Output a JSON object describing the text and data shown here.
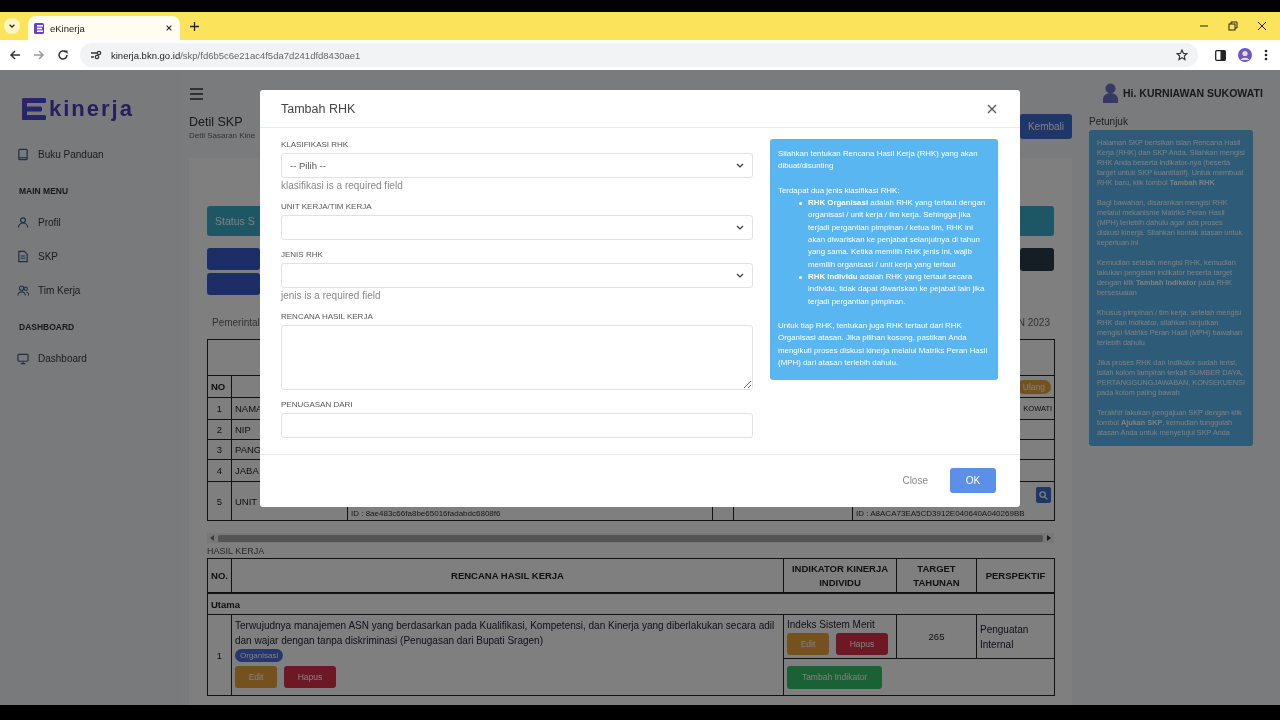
{
  "browser": {
    "tab_title": "eKinerja",
    "url": {
      "domain": "kinerja.bkn.go.id",
      "path": "/skp/fd6b5c6e21ac4f5da7d241dfd8430ae1"
    }
  },
  "sidebar": {
    "logo": "kinerja",
    "items": [
      {
        "kind": "link",
        "label": "Buku Panduan"
      },
      {
        "kind": "heading",
        "label": "MAIN MENU"
      },
      {
        "kind": "link",
        "label": "Profil"
      },
      {
        "kind": "link",
        "label": "SKP"
      },
      {
        "kind": "link",
        "label": "Tim Kerja"
      },
      {
        "kind": "heading",
        "label": "DASHBOARD"
      },
      {
        "kind": "link",
        "label": "Dashboard"
      }
    ]
  },
  "header": {
    "title": "Detil SKP",
    "subtitle": "Detil Sasaran Kine",
    "back_button": "Kembali"
  },
  "status_bar": {
    "label": "Status S"
  },
  "period": {
    "left": "Pemerintal",
    "right": "N 2023"
  },
  "profile_table": {
    "column_no": "NO",
    "badge": "Ulang",
    "rows": [
      {
        "no": "1",
        "label": "NAMA",
        "right": "KOWATI"
      },
      {
        "no": "2",
        "label": "NIP"
      },
      {
        "no": "3",
        "label": "PANG"
      },
      {
        "no": "4",
        "label": "JABA"
      },
      {
        "no": "5",
        "label": "UNIT",
        "left_id": "ID : 8ae483c66fa8be65016fadabdc6808f6",
        "right_id": "ID : A8ACA73EA5CD3912E040640A040269BB"
      }
    ]
  },
  "hasil_kerja": {
    "title": "HASIL KERJA",
    "columns": [
      "NO.",
      "RENCANA HASIL KERJA",
      "INDIKATOR KINERJA INDIVIDU",
      "TARGET TAHUNAN",
      "PERSPEKTIF"
    ],
    "groups": [
      {
        "name": "Utama",
        "rows": [
          {
            "no": "1",
            "rhk": "Terwujudnya manajemen ASN yang berdasarkan pada Kualifikasi, Kompetensi, dan Kinerja yang diberlakukan secara adil dan wajar dengan tanpa diskriminasi (Penugasan dari Bupati Sragen)",
            "tag": "Organisasi",
            "edit": "Edit",
            "delete": "Hapus",
            "indicator": {
              "name": "Indeks Sistem Merit",
              "edit": "Edit",
              "delete": "Hapus",
              "target": "265",
              "perspective": "Penguatan Internal"
            },
            "add_indicator": "Tambah Indikator"
          }
        ]
      }
    ]
  },
  "user": {
    "greeting": "Hi. KURNIAWAN SUKOWATI"
  },
  "guide": {
    "title": "Petunjuk",
    "paragraphs": [
      "Halaman SKP berisikan isian Rencana Hasil Kerja (RHK) dan SKP Anda. Silahkan mengisi RHK Anda beserta indikator-nya (beserta target untuk SKP kuantitatif). Untuk membuat RHK baru, klik tombol **Tambah RHK**",
      "Bagi bawahan, disarankan mengisi RHK melalui mekanisme Matriks Peran Hasil (MPH) terlebih dahulu agar ada proses diskusi kinerja. Silahkan kontak atasan untuk keperluan ini",
      "Kemudian setelah mengisi RHK, kemudian lakukan pengisian indikator beserta target dengan klik **Tambah Indikator** pada RHK bersesuaian",
      "Khusus pimpinan / tim kerja, setelah mengisi RHK dan Indikator, silahkan lanjutkan mengisi Matriks Peran Hasil (MPH) bawahan terlebih dahulu",
      "Jika proses RHK dan Indikator sudah terisi, isilah kolom lampiran terkait SUMBER DAYA, PERTANGGUNGJAWABAN, KONSEKUENSI pada kolom paling bawah",
      "Terakhir lakukan pengajuan SKP dengan klik tombol **Ajukan SKP**, kemudian tunggulah atasan Anda untuk menyetujui SKP Anda"
    ]
  },
  "modal": {
    "title": "Tambah RHK",
    "fields": [
      {
        "kind": "select",
        "label": "KLASIFIKASI RHK",
        "value": "-- Pilih --",
        "error": "klasifikasi is a required field"
      },
      {
        "kind": "select",
        "label": "UNIT KERJA/TIM KERJA"
      },
      {
        "kind": "select",
        "label": "JENIS RHK",
        "error": "jenis is a required field"
      },
      {
        "kind": "textarea",
        "label": "RENCANA HASIL KERJA"
      },
      {
        "kind": "input",
        "label": "PENUGASAN DARI"
      }
    ],
    "info": {
      "intro": "Silahkan tentukan Rencana Hasil Kerja (RHK) yang akan dibuat/disunting",
      "list_intro": "Terdapat dua jenis klasifikasi RHK:",
      "items": [
        "**RHK Organisasi** adalah RHK yang tertaut dengan organisasi / unit kerja / tim kerja. Sehingga jika terjadi pergantian pimpinan / ketua tim, RHK ini akan diwariskan ke penjabat selanjutnya di tahun yang sama. Ketika memilih RHK jenis ini, wajib memilih organisasi / unit kerja yang tertaut",
        "**RHK Individu** adalah RHK yang tertaut secara individu, tidak dapat diwariskan ke pejabat lain jika terjadi pergantian pimpinan."
      ],
      "outro": "Untuk tiap RHK, tentukan juga RHK tertaut dari RHK Organisasi atasan. Jika pilihan kosong, pastikan Anda mengikuti proses diskusi kinerja melalui Matriks Peran Hasil (MPH) dari atasan terlebih dahulu."
    },
    "buttons": {
      "close": "Close",
      "ok": "OK"
    }
  }
}
